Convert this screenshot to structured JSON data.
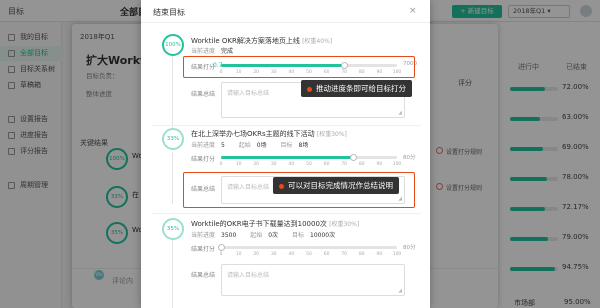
{
  "app": {
    "brand": "目标",
    "header_title": "全部目标",
    "new_goal_label": "+ 新建目标",
    "quarter_select": "2018年Q1 ▾"
  },
  "sidebar": {
    "items": [
      {
        "label": "我的目标"
      },
      {
        "label": "全部目标"
      },
      {
        "label": "目标关系树"
      },
      {
        "label": "草稿箱"
      },
      {
        "label": "设置报告"
      },
      {
        "label": "进度报告"
      },
      {
        "label": "评分报告"
      },
      {
        "label": "周期管理"
      }
    ]
  },
  "right_panel": {
    "col_in_progress": "进行中",
    "col_done": "已结束",
    "values": [
      "72.00%",
      "63.00%",
      "69.00%",
      "78.00%",
      "72.17%",
      "79.00%",
      "94.75%"
    ],
    "fractions": [
      0.72,
      0.63,
      0.69,
      0.78,
      0.7217,
      0.79,
      0.9475
    ],
    "bottom_label": "市场部",
    "bottom_value": "95.00%"
  },
  "dialog2": {
    "quarter": "2018年Q1",
    "title": "扩大Worktile",
    "meta_target": "目标负责：",
    "meta_overall": "整体进度",
    "key_results": "关键结果",
    "score_label": "评分",
    "rings": [
      "100%",
      "33%",
      "35%"
    ],
    "items": [
      "Wo",
      "在",
      "Wo"
    ],
    "right_label": "设置打分规则",
    "comment_placeholder": "评论内",
    "badge": "Ws"
  },
  "modal": {
    "title": "结束目标",
    "close_icon": "×",
    "krs": [
      {
        "ring": "100%",
        "title": "Worktile OKR解决方案落地页上线",
        "weight": "[权重40%]",
        "meta": [
          {
            "k": "当前进度",
            "v": "完成"
          }
        ],
        "score_label": "结果打分",
        "score_value": "0.7",
        "score_fraction": 0.7,
        "score_max": "7000",
        "summary_label": "结果总结",
        "summary_placeholder": "请输入目标总结"
      },
      {
        "ring": "33%",
        "title": "在北上深举办七场OKRs主题的线下活动",
        "weight": "[权重30%]",
        "meta": [
          {
            "k": "当前进度",
            "v": "5"
          },
          {
            "k": "起始",
            "v": "0场"
          },
          {
            "k": "目标",
            "v": "8场"
          }
        ],
        "score_label": "结果打分",
        "score_value": "",
        "score_fraction": 0.75,
        "score_max": "80分",
        "summary_label": "结果总结",
        "summary_placeholder": "请输入目标总结"
      },
      {
        "ring": "35%",
        "title": "Worktile的OKR电子书下载量达到10000次",
        "weight": "[权重30%]",
        "meta": [
          {
            "k": "当前进度",
            "v": "3500"
          },
          {
            "k": "起始",
            "v": "0次"
          },
          {
            "k": "目标",
            "v": "10000次"
          }
        ],
        "score_label": "结果打分",
        "score_value": "",
        "score_fraction": 0.0,
        "score_max": "80分",
        "summary_label": "结果总结",
        "summary_placeholder": "请输入目标总结"
      }
    ],
    "ticks": [
      "0",
      "10",
      "20",
      "30",
      "40",
      "50",
      "60",
      "70",
      "80",
      "90",
      "100"
    ],
    "callout_1": "推动进度条即可给目标打分",
    "callout_2": "可以对目标完成情况作总结说明"
  },
  "colors": {
    "accent": "#22c29c",
    "highlight": "#e64a19"
  }
}
